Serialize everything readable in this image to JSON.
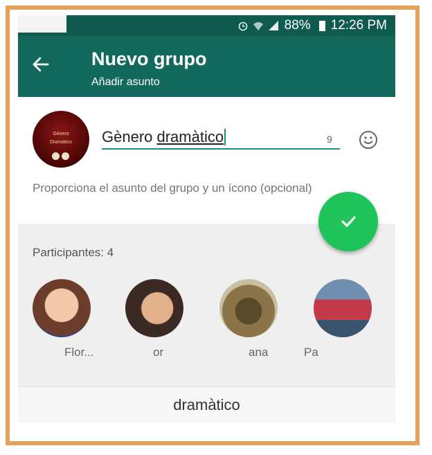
{
  "status_bar": {
    "battery": "88%",
    "time": "12:26 PM"
  },
  "app_bar": {
    "title": "Nuevo grupo",
    "subtitle": "Añadir asunto"
  },
  "group_avatar": {
    "line1": "Género",
    "line2": "Dramático"
  },
  "subject_input": {
    "value_part1": "Gènero ",
    "value_part2": "dramàtico",
    "char_count": "9"
  },
  "hint_text": "Proporciona el asunto del grupo y un ícono (opcional)",
  "participants": {
    "label": "Participantes: 4",
    "items": [
      {
        "name": "Flor...",
        "avatar_color": "#6b3d2a"
      },
      {
        "name": "or",
        "avatar_color": "#3b2a24"
      },
      {
        "name": "ana",
        "avatar_color": "#6a5a30"
      },
      {
        "name": "Pa",
        "avatar_color": "#3a5470"
      }
    ]
  },
  "suggestion": "dramàtico",
  "colors": {
    "header": "#136a5c",
    "accent": "#1d8f7e",
    "fab": "#1fc45a",
    "frame": "#e8a15a"
  },
  "icons": {
    "back": "back-arrow-icon",
    "emoji": "smiley-icon",
    "fab": "checkmark-icon"
  }
}
